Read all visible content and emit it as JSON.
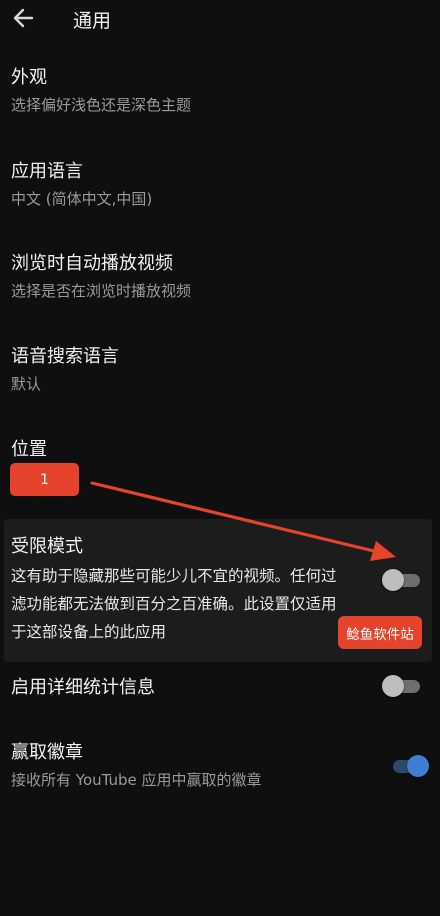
{
  "header": {
    "title": "通用"
  },
  "settings": [
    {
      "title": "外观",
      "subtitle": "选择偏好浅色还是深色主题"
    },
    {
      "title": "应用语言",
      "subtitle": "中文 (简体中文,中国)"
    },
    {
      "title": "浏览时自动播放视频",
      "subtitle": "选择是否在浏览时播放视频"
    },
    {
      "title": "语音搜索语言",
      "subtitle": "默认"
    },
    {
      "title": "位置"
    }
  ],
  "location_badge": "1",
  "restricted_mode": {
    "title": "受限模式",
    "description": "这有助于隐藏那些可能少儿不宜的视频。任何过滤功能都无法做到百分之百准确。此设置仅适用于这部设备上的此应用",
    "enabled": false
  },
  "stats": {
    "title": "启用详细统计信息",
    "enabled": false
  },
  "badges": {
    "title": "赢取徽章",
    "subtitle": "接收所有 YouTube 应用中赢取的徽章",
    "enabled": true
  },
  "watermark": "鲶鱼软件站",
  "colors": {
    "accent": "#e5432b",
    "toggle_on": "#3e7fd4",
    "background": "#0f0f0f"
  }
}
